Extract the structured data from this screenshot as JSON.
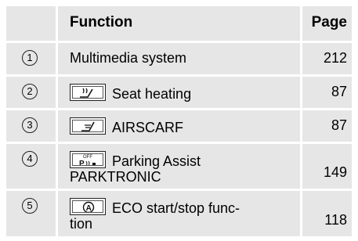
{
  "header": {
    "col_function": "Function",
    "col_page": "Page"
  },
  "rows": [
    {
      "num": "1",
      "function": "Multimedia system",
      "page": "212"
    },
    {
      "num": "2",
      "function": "Seat heating",
      "page": "87",
      "icon": "seat-heating-icon"
    },
    {
      "num": "3",
      "function": "AIRSCARF",
      "page": "87",
      "icon": "airscarf-icon"
    },
    {
      "num": "4",
      "function_line1": "Parking Assist",
      "function_line2": "PARKTRONIC",
      "page": "149",
      "icon": "parktronic-icon",
      "icon_text": "OFF"
    },
    {
      "num": "5",
      "function_line1": "ECO start/stop func-",
      "function_line2": "tion",
      "page": "118",
      "icon": "eco-start-stop-icon",
      "icon_text": "A"
    }
  ]
}
